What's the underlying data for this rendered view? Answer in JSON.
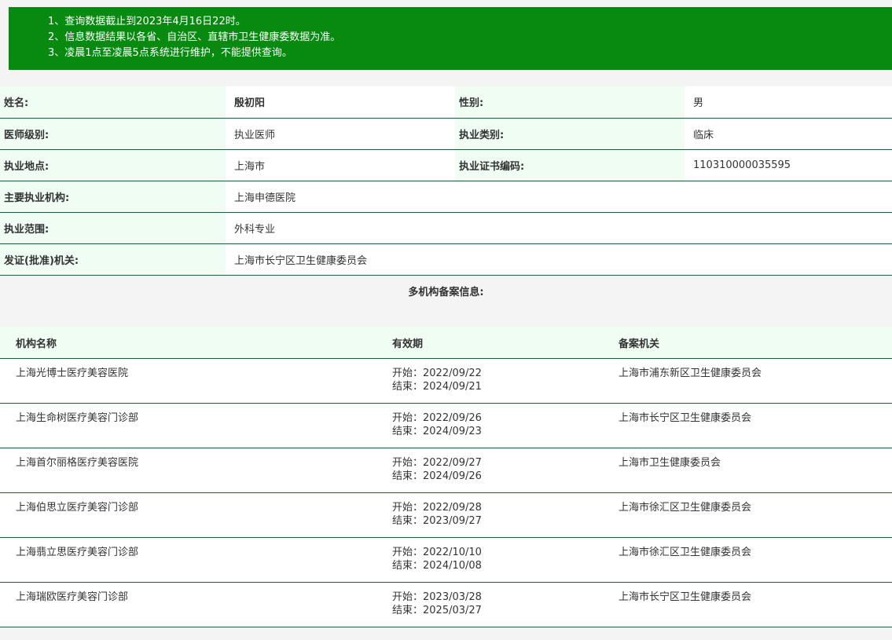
{
  "notice": {
    "lines": [
      "1、查询数据截止到2023年4月16日22时。",
      "2、信息数据结果以各省、自治区、直辖市卫生健康委数据为准。",
      "3、凌晨1点至凌晨5点系统进行维护，不能提供查询。"
    ]
  },
  "profile": {
    "name_label": "姓名:",
    "name": "殷初阳",
    "gender_label": "性别:",
    "gender": "男",
    "level_label": "医师级别:",
    "level": "执业医师",
    "category_label": "执业类别:",
    "category": "临床",
    "location_label": "执业地点:",
    "location": "上海市",
    "cert_label": "执业证书编码:",
    "cert_no": "110310000035595",
    "institution_label": "主要执业机构:",
    "institution": "上海申德医院",
    "scope_label": "执业范围:",
    "scope": "外科专业",
    "issuer_label": "发证(批准)机关:",
    "issuer": "上海市长宁区卫生健康委员会"
  },
  "multi": {
    "title": "多机构备案信息:",
    "headers": {
      "name": "机构名称",
      "period": "有效期",
      "org": "备案机关"
    },
    "rows": [
      {
        "name": "上海光博士医疗美容医院",
        "start": "开始：2022/09/22",
        "end": "结束：2024/09/21",
        "org": "上海市浦东新区卫生健康委员会"
      },
      {
        "name": "上海生命树医疗美容门诊部",
        "start": "开始：2022/09/26",
        "end": "结束：2024/09/23",
        "org": "上海市长宁区卫生健康委员会"
      },
      {
        "name": "上海首尔丽格医疗美容医院",
        "start": "开始：2022/09/27",
        "end": "结束：2024/09/26",
        "org": "上海市卫生健康委员会"
      },
      {
        "name": "上海伯思立医疗美容门诊部",
        "start": "开始：2022/09/28",
        "end": "结束：2023/09/27",
        "org": "上海市徐汇区卫生健康委员会"
      },
      {
        "name": "上海翡立思医疗美容门诊部",
        "start": "开始：2022/10/10",
        "end": "结束：2024/10/08",
        "org": "上海市徐汇区卫生健康委员会"
      },
      {
        "name": "上海瑞欧医疗美容门诊部",
        "start": "开始：2023/03/28",
        "end": "结束：2025/03/27",
        "org": "上海市长宁区卫生健康委员会"
      }
    ]
  }
}
